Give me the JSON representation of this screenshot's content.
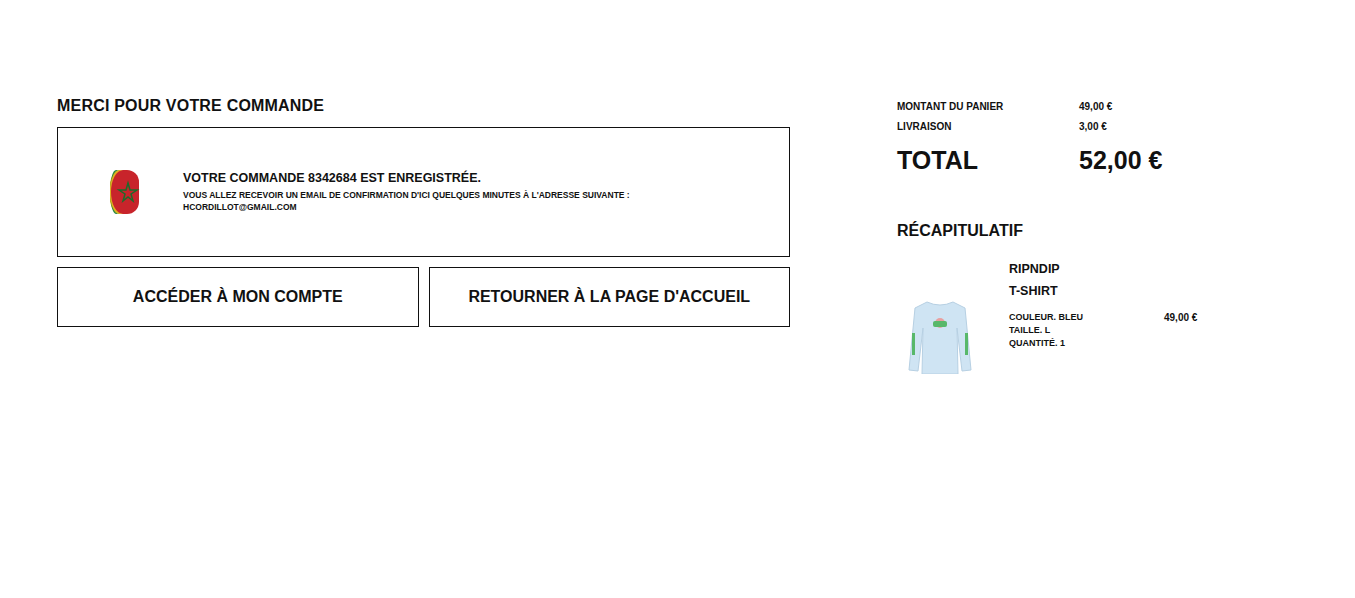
{
  "page": {
    "title": "MERCI POUR VOTRE COMMANDE"
  },
  "confirmation": {
    "message": "VOTRE COMMANDE 8342684 EST ENREGISTRÉE.",
    "note": "VOUS ALLEZ RECEVOIR UN EMAIL DE CONFIRMATION D'ICI QUELQUES MINUTES À L'ADRESSE SUIVANTE :",
    "email": "HCORDILLOT@GMAIL.COM"
  },
  "buttons": [
    "ACCÉDER À MON COMPTE",
    "RETOURNER À LA PAGE D'ACCUEIL"
  ],
  "summary": {
    "rows": [
      {
        "label": "MONTANT DU PANIER",
        "value": "49,00 €"
      },
      {
        "label": "LIVRAISON",
        "value": "3,00 €"
      }
    ],
    "total": {
      "label": "TOTAL",
      "value": "52,00 €"
    }
  },
  "recap": {
    "title": "RÉCAPITULATIF",
    "items": [
      {
        "brand": "RIPNDIP",
        "name": "T-SHIRT",
        "details": [
          "COULEUR. BLEU",
          "TAILLE. L",
          "QUANTITÉ. 1"
        ],
        "price": "49,00 €"
      }
    ]
  }
}
